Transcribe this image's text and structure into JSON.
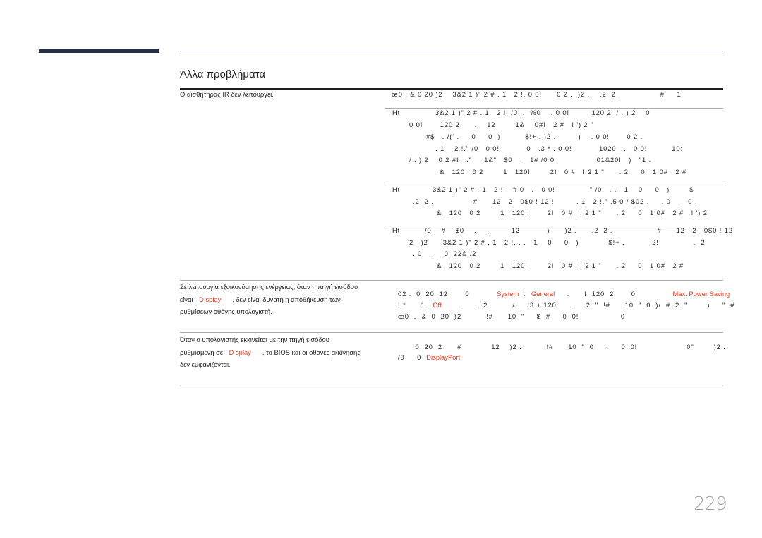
{
  "section": {
    "title": "Άλλα προβλήματα"
  },
  "page": {
    "number": "229"
  },
  "rows": [
    {
      "problem": "Ο αισθητήρας IR δεν λειτουργεί.",
      "intro": "œ0 . & 0 20 )2    3&2 1 )\" 2 # . 1   2 !. 0 0!      0 2 .  )2 .    .2  2 .                #     1",
      "items": [
        {
          "marker": "Ht",
          "lines": [
            "3&2 1 )\" 2 # . 1   2 !. /0  .  %0    . 0 0!         120 2  / . ) 2    0",
            "0 0!       120 2      .    12        1&    0#!   2 #   ! ') 2 \"",
            "#$   . /(' .     0     0  )          $!+ . )2 .         )    . 0 0!       0 2 .",
            ". 1    2 !.\" /0   0 0!           0   .3 * . 0 0!           1020   .   0 0!          10:",
            "/ . ) 2    0 2 #!   .\"     1&\"   $0   .   1# /0 0                 01&20!   )   \"1 .",
            "&   120   0 2        1   120!        2!   0 #   ! 2 1 \"      . 2     0   1 0#   2 #"
          ]
        },
        {
          "marker": "Ht",
          "lines": [
            "3&2 1 )\" 2 # . 1   2 !.   # 0   .   0 0!              \" /0   . .   1    0     0   )        $",
            ".2  2 .                #      12   2   0$0 ! 12 !         . 1   2 !.\" ,5 0 / $02 .     . 0   .   0 .",
            "&   120   0 2        1   120!        2!   0 #   ! 2 1 \"      . 2     0   1 0#   2 #   ! ') 2"
          ]
        },
        {
          "marker": "Ht",
          "lines": [
            "/0    #   !$0    .     .        12           )      )2 .      .2  2 .                  #      12   2   0$0 ! 12",
            "2   )2      3&2 1 )\" 2 # . 1   2 !. . .   1    0     0   )            $!+ .           2!              .  2",
            ". 0    .    0 .22& .2",
            "&   120   0 2        1   120!        2!   0 #   ! 2 1 \"      . 2     0   1 0#   2 #"
          ]
        }
      ]
    },
    {
      "problem_parts": [
        "Σε λειτουργία εξοικονόμησης ενέργειας, όταν η πηγή εισόδου είναι",
        "D splay",
        ", δεν είναι δυνατή η αποθήκευση των ρυθμίσεων οθόνης υπολογιστή."
      ],
      "solution_lines": [
        {
          "parts": [
            "02 .  0  20  12       0           ",
            "System",
            "  :  ",
            "General",
            "     .      !  120  2       0               ",
            "Max. Power Saving"
          ]
        },
        {
          "parts": [
            "! *      1   ",
            "Off",
            "        .    .   2          / .   !3 + 120      .     2  \"  !#      10  \"  0  )/  #  2  \"        )     \"  #"
          ]
        },
        {
          "parts": [
            "œ0  .  &  0  20  )2          !#      10  \"     $  #     0  0!                 0"
          ]
        }
      ]
    },
    {
      "problem_parts": [
        "Όταν ο υπολογιστής εκκινείται με την πηγή εισόδου ρυθμισμένη σε",
        "D splay",
        ", το BIOS και οι οθόνες εκκίνησης δεν εμφανίζονται."
      ],
      "solution_lines": [
        {
          "parts": [
            "       0  20  2      #            12    )2 .          !#      10  \"  0     .     0  0!                    0\"        )2 ."
          ]
        },
        {
          "parts": [
            "/0     0  ",
            "DisplayPort"
          ]
        }
      ]
    }
  ]
}
